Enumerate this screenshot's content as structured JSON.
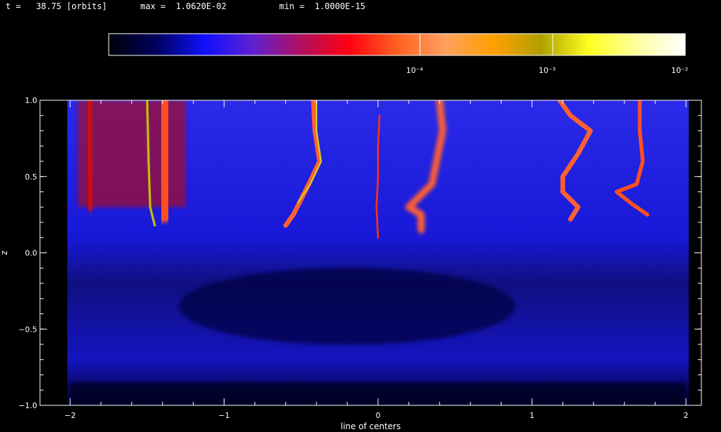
{
  "header": {
    "time_label": "t =",
    "time_value": "38.75",
    "time_unit": "[orbits]",
    "max_label": "max =",
    "max_value": "1.0620E-02",
    "min_label": "min =",
    "min_value": "1.0000E-15"
  },
  "colorbar": {
    "scale": "log",
    "ticks": [
      {
        "value": 0.0001,
        "label": "10⁻⁴"
      },
      {
        "value": 0.001,
        "label": "10⁻³"
      },
      {
        "value": 0.01,
        "label": "10⁻²"
      }
    ],
    "colormap": [
      "#000008",
      "#000060",
      "#1010ff",
      "#6020d0",
      "#b01060",
      "#ff0010",
      "#ff6020",
      "#ffa060",
      "#ffa000",
      "#b0a000",
      "#ffff20",
      "#ffffa0",
      "#ffffff"
    ]
  },
  "chart_data": {
    "type": "heatmap",
    "xlabel": "line of centers",
    "ylabel": "z",
    "xlim": [
      -2.0,
      2.0
    ],
    "ylim": [
      -1.0,
      1.0
    ],
    "x_ticks": [
      {
        "value": -2,
        "label": "−2"
      },
      {
        "value": -1,
        "label": "−1"
      },
      {
        "value": 0,
        "label": "0"
      },
      {
        "value": 1,
        "label": "1"
      },
      {
        "value": 2,
        "label": "2"
      }
    ],
    "y_ticks": [
      {
        "value": 1.0,
        "label": "1.0"
      },
      {
        "value": 0.5,
        "label": "0.5"
      },
      {
        "value": 0.0,
        "label": "0.0"
      },
      {
        "value": -0.5,
        "label": "−0.5"
      },
      {
        "value": -1.0,
        "label": "−1.0"
      }
    ],
    "field": {
      "background_color": "#1a1aee",
      "dark_region_color": "#000040",
      "filaments": [
        {
          "color": "#cc1010",
          "width": 0.06,
          "points": [
            [
              -1.88,
              1.0
            ],
            [
              -1.88,
              0.6
            ],
            [
              -1.86,
              0.3
            ]
          ]
        },
        {
          "color": "#ff5020",
          "width": 0.2,
          "points": [
            [
              -1.38,
              1.0
            ],
            [
              -1.37,
              0.7
            ],
            [
              -1.38,
              0.4
            ],
            [
              -1.4,
              0.3
            ]
          ]
        },
        {
          "color": "#c0c000",
          "width": 0.015,
          "points": [
            [
              -1.5,
              1.0
            ],
            [
              -1.49,
              0.6
            ],
            [
              -1.48,
              0.3
            ],
            [
              -1.45,
              0.18
            ]
          ]
        },
        {
          "color": "#ff6030",
          "width": 0.03,
          "points": [
            [
              -0.42,
              1.0
            ],
            [
              -0.41,
              0.8
            ],
            [
              -0.38,
              0.6
            ],
            [
              -0.45,
              0.45
            ],
            [
              -0.5,
              0.35
            ],
            [
              -0.55,
              0.25
            ],
            [
              -0.6,
              0.18
            ]
          ]
        },
        {
          "color": "#d0d020",
          "width": 0.01,
          "points": [
            [
              -0.4,
              1.0
            ],
            [
              -0.4,
              0.8
            ],
            [
              -0.37,
              0.6
            ],
            [
              -0.44,
              0.45
            ],
            [
              -0.52,
              0.33
            ]
          ]
        },
        {
          "color": "#ff3010",
          "width": 0.012,
          "points": [
            [
              0.01,
              0.9
            ],
            [
              0.0,
              0.7
            ],
            [
              0.0,
              0.5
            ],
            [
              -0.01,
              0.3
            ],
            [
              0.0,
              0.1
            ]
          ]
        },
        {
          "color": "#ff6030",
          "width": 0.045,
          "points": [
            [
              0.4,
              1.0
            ],
            [
              0.42,
              0.8
            ],
            [
              0.38,
              0.6
            ],
            [
              0.35,
              0.45
            ],
            [
              0.25,
              0.35
            ],
            [
              0.2,
              0.3
            ],
            [
              0.28,
              0.25
            ],
            [
              0.28,
              0.15
            ]
          ]
        },
        {
          "color": "#ff6030",
          "width": 0.03,
          "points": [
            [
              1.18,
              1.0
            ],
            [
              1.25,
              0.9
            ],
            [
              1.38,
              0.8
            ],
            [
              1.3,
              0.65
            ],
            [
              1.2,
              0.5
            ],
            [
              1.2,
              0.4
            ],
            [
              1.3,
              0.3
            ],
            [
              1.25,
              0.22
            ]
          ]
        },
        {
          "color": "#ff5020",
          "width": 0.025,
          "points": [
            [
              1.7,
              1.0
            ],
            [
              1.7,
              0.8
            ],
            [
              1.72,
              0.6
            ],
            [
              1.68,
              0.45
            ],
            [
              1.55,
              0.4
            ],
            [
              1.65,
              0.32
            ],
            [
              1.75,
              0.25
            ]
          ]
        }
      ]
    }
  }
}
